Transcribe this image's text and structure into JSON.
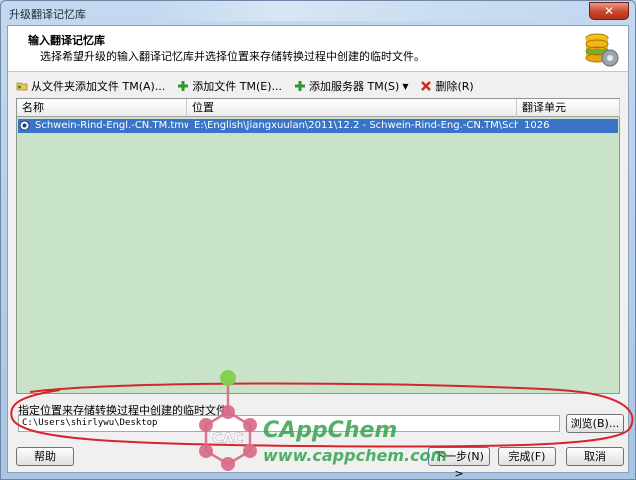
{
  "window": {
    "title": "升级翻译记忆库",
    "close_label": "✕"
  },
  "banner": {
    "title": "输入翻译记忆库",
    "subtitle": "选择希望升级的输入翻译记忆库并选择位置来存储转换过程中创建的临时文件。"
  },
  "toolbar": {
    "add_from_folder": "从文件夹添加文件 TM(A)...",
    "add_file": "添加文件 TM(E)...",
    "add_server": "添加服务器 TM(S)",
    "delete": "删除(R)"
  },
  "list": {
    "columns": [
      "名称",
      "位置",
      "翻译单元"
    ],
    "rows": [
      {
        "name": "Schwein-Rind-Engl.-CN.TM.tmw",
        "location": "E:\\English\\Jiangxuulan\\2011\\12.2 - Schwein-Rind-Eng.-CN.TM\\Schwein-Rind-E...",
        "units": "1026"
      }
    ]
  },
  "temp": {
    "label": "指定位置来存储转换过程中创建的临时文件:",
    "path": "C:\\Users\\shirlywu\\Desktop",
    "browse_label": "浏览(B)..."
  },
  "buttons": {
    "help": "帮助",
    "next": "下一步(N) >",
    "finish": "完成(F)",
    "cancel": "取消"
  },
  "watermark": {
    "logo_text": "CAC",
    "brand": "CAppChem",
    "url": "www.cappchem.com"
  },
  "colors": {
    "list_background": "#c9e3c8",
    "selection": "#3b73c9",
    "annotation": "#d8252b",
    "watermark": "#34a34f"
  }
}
